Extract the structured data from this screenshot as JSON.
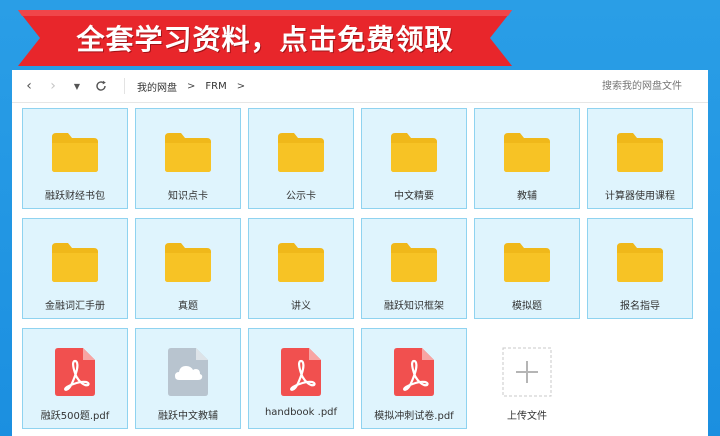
{
  "banner": {
    "text": "全套学习资料，点击免费领取",
    "color": "#e8262b"
  },
  "toolbar": {
    "back_icon": "chevron-left-icon",
    "forward_icon": "chevron-right-icon",
    "refresh_icon": "refresh-icon",
    "breadcrumb": [
      "我的网盘",
      "FRM"
    ],
    "search_placeholder": "搜索我的网盘文件"
  },
  "files": [
    {
      "name": "融跃财经书包",
      "type": "folder"
    },
    {
      "name": "知识点卡",
      "type": "folder"
    },
    {
      "name": "公示卡",
      "type": "folder"
    },
    {
      "name": "中文精要",
      "type": "folder"
    },
    {
      "name": "教辅",
      "type": "folder"
    },
    {
      "name": "计算器使用课程",
      "type": "folder"
    },
    {
      "name": "金融词汇手册",
      "type": "folder"
    },
    {
      "name": "真题",
      "type": "folder"
    },
    {
      "name": "讲义",
      "type": "folder"
    },
    {
      "name": "融跃知识框架",
      "type": "folder"
    },
    {
      "name": "模拟题",
      "type": "folder"
    },
    {
      "name": "报名指导",
      "type": "folder"
    },
    {
      "name": "融跃500题.pdf",
      "type": "pdf"
    },
    {
      "name": "融跃中文教辅",
      "type": "cloud"
    },
    {
      "name": "handbook .pdf",
      "type": "pdf"
    },
    {
      "name": "模拟冲刺试卷.pdf",
      "type": "pdf"
    }
  ],
  "upload": {
    "label": "上传文件",
    "icon": "plus-icon"
  },
  "colors": {
    "folder": "#f7c325",
    "pdf": "#f1504f",
    "cloud": "#b8c4cf",
    "selected_bg": "#dff4fd",
    "selected_border": "#8fd3f0"
  }
}
